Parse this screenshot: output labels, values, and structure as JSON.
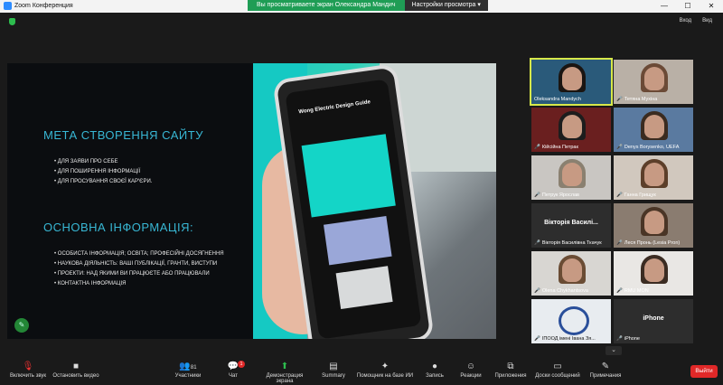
{
  "window": {
    "title": "Zoom Конференция",
    "controls": [
      "—",
      "☐",
      "✕"
    ]
  },
  "share_banner": {
    "message": "Вы просматриваете экран Олександра Мандич",
    "options_label": "Настройки просмотра",
    "options_icon": "chevron-down-icon"
  },
  "top_right": {
    "view_label": "Вход",
    "gallery_label": "Вид"
  },
  "slide": {
    "heading1": "МЕТА СТВОРЕННЯ САЙТУ",
    "list1": [
      "ДЛЯ ЗАЯВИ ПРО СЕБЕ",
      "ДЛЯ ПОШИРЕННЯ ІНФОРМАЦІЇ",
      "ДЛЯ ПРОСУВАННЯ СВОЄЇ КАР'ЄРИ."
    ],
    "heading2": "ОСНОВНА ІНФОРМАЦІЯ:",
    "list2": [
      "ОСОБИСТА ІНФОРМАЦІЯ; ОСВІТА; ПРОФЕСІЙНІ ДОСЯГНЕННЯ",
      "НАУКОВА ДІЯЛЬНІСТЬ: ВАШІ ПУБЛІКАЦІЇ, ГРАНТИ, ВИСТУПИ",
      "ПРОЕКТИ: НАД ЯКИМИ ВИ ПРАЦЮЄТЕ АБО ПРАЦЮВАЛИ",
      "КОНТАКТНА ІНФОРМАЦІЯ"
    ],
    "phone_text": "Wong Electric Design Guide"
  },
  "participants": [
    {
      "name": "Oleksandra Mandych",
      "muted": false,
      "active": true
    },
    {
      "name": "Тетяна Мухіна",
      "muted": true
    },
    {
      "name": "Кійсійна Петрак",
      "muted": true
    },
    {
      "name": "Denys Borysenko, UEFA",
      "muted": true
    },
    {
      "name": "Петрук Ярослав",
      "muted": true
    },
    {
      "name": "Ганна Грищук",
      "muted": true
    },
    {
      "name": "Вікторія Василівна Ткачук",
      "muted": true,
      "big_label": "Вікторія Василі..."
    },
    {
      "name": "Леся Пронь (Lesia Pron)",
      "muted": true
    },
    {
      "name": "Olena Chykhantsova",
      "muted": true
    },
    {
      "name": "RMU MON",
      "muted": true
    },
    {
      "name": "ІПООД імені Івана Зя...",
      "muted": true
    },
    {
      "name": "iPhone",
      "muted": true,
      "big_label": "iPhone"
    }
  ],
  "toolbar": {
    "mute": "Включить звук",
    "video": "Остановить видео",
    "participants": "Участники",
    "participants_count": "81",
    "chat": "Чат",
    "chat_badge": "1",
    "share": "Демонстрация экрана",
    "summary": "Summary",
    "ai": "Помощник на базе ИИ",
    "record": "Запись",
    "reactions": "Реакции",
    "apps": "Приложения",
    "whiteboards": "Доски сообщений",
    "notes": "Примечания",
    "end": "Выйти"
  },
  "colors": {
    "accent": "#38b7d4",
    "share_green": "#1f9d55",
    "end_red": "#e02828",
    "active_outline": "#d7e84a"
  }
}
